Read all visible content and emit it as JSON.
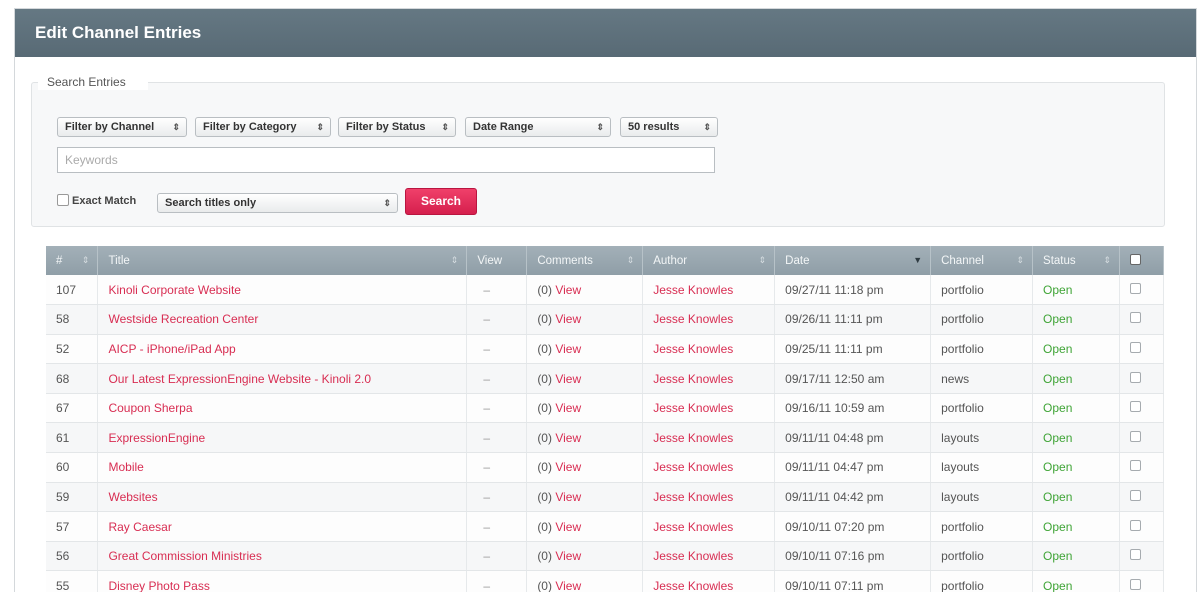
{
  "header": {
    "title": "Edit Channel Entries"
  },
  "search": {
    "legend": "Search Entries",
    "filters": [
      {
        "label": "Filter by Channel"
      },
      {
        "label": "Filter by Category"
      },
      {
        "label": "Filter by Status"
      },
      {
        "label": "Date Range"
      },
      {
        "label": "50 results"
      }
    ],
    "keywords_placeholder": "Keywords",
    "exact_match_label": "Exact Match",
    "scope_select": "Search titles only",
    "search_button": "Search"
  },
  "table": {
    "columns": [
      "#",
      "Title",
      "View",
      "Comments",
      "Author",
      "Date",
      "Channel",
      "Status"
    ],
    "rows": [
      {
        "id": "107",
        "title": "Kinoli Corporate Website",
        "view": "–",
        "comments_count": "(0)",
        "comments_link": "View",
        "author": "Jesse Knowles",
        "date": "09/27/11 11:18 pm",
        "channel": "portfolio",
        "status": "Open"
      },
      {
        "id": "58",
        "title": "Westside Recreation Center",
        "view": "–",
        "comments_count": "(0)",
        "comments_link": "View",
        "author": "Jesse Knowles",
        "date": "09/26/11 11:11 pm",
        "channel": "portfolio",
        "status": "Open"
      },
      {
        "id": "52",
        "title": "AICP - iPhone/iPad App",
        "view": "–",
        "comments_count": "(0)",
        "comments_link": "View",
        "author": "Jesse Knowles",
        "date": "09/25/11 11:11 pm",
        "channel": "portfolio",
        "status": "Open"
      },
      {
        "id": "68",
        "title": "Our Latest ExpressionEngine Website - Kinoli 2.0",
        "view": "–",
        "comments_count": "(0)",
        "comments_link": "View",
        "author": "Jesse Knowles",
        "date": "09/17/11 12:50 am",
        "channel": "news",
        "status": "Open"
      },
      {
        "id": "67",
        "title": "Coupon Sherpa",
        "view": "–",
        "comments_count": "(0)",
        "comments_link": "View",
        "author": "Jesse Knowles",
        "date": "09/16/11 10:59 am",
        "channel": "portfolio",
        "status": "Open"
      },
      {
        "id": "61",
        "title": "ExpressionEngine",
        "view": "–",
        "comments_count": "(0)",
        "comments_link": "View",
        "author": "Jesse Knowles",
        "date": "09/11/11 04:48 pm",
        "channel": "layouts",
        "status": "Open"
      },
      {
        "id": "60",
        "title": "Mobile",
        "view": "–",
        "comments_count": "(0)",
        "comments_link": "View",
        "author": "Jesse Knowles",
        "date": "09/11/11 04:47 pm",
        "channel": "layouts",
        "status": "Open"
      },
      {
        "id": "59",
        "title": "Websites",
        "view": "–",
        "comments_count": "(0)",
        "comments_link": "View",
        "author": "Jesse Knowles",
        "date": "09/11/11 04:42 pm",
        "channel": "layouts",
        "status": "Open"
      },
      {
        "id": "57",
        "title": "Ray Caesar",
        "view": "–",
        "comments_count": "(0)",
        "comments_link": "View",
        "author": "Jesse Knowles",
        "date": "09/10/11 07:20 pm",
        "channel": "portfolio",
        "status": "Open"
      },
      {
        "id": "56",
        "title": "Great Commission Ministries",
        "view": "–",
        "comments_count": "(0)",
        "comments_link": "View",
        "author": "Jesse Knowles",
        "date": "09/10/11 07:16 pm",
        "channel": "portfolio",
        "status": "Open"
      },
      {
        "id": "55",
        "title": "Disney Photo Pass",
        "view": "–",
        "comments_count": "(0)",
        "comments_link": "View",
        "author": "Jesse Knowles",
        "date": "09/10/11 07:11 pm",
        "channel": "portfolio",
        "status": "Open"
      }
    ]
  },
  "colors": {
    "accent": "#d82d52",
    "status_open": "#3fa436",
    "header_bg": "#5e707b"
  }
}
